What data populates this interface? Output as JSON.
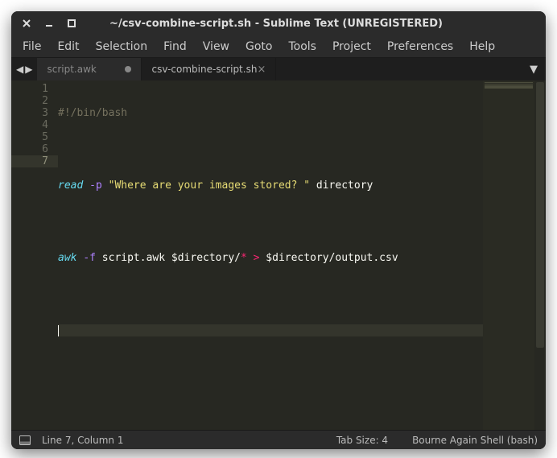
{
  "titlebar": {
    "title": "~/csv-combine-script.sh - Sublime Text (UNREGISTERED)"
  },
  "menubar": {
    "items": [
      "File",
      "Edit",
      "Selection",
      "Find",
      "View",
      "Goto",
      "Tools",
      "Project",
      "Preferences",
      "Help"
    ]
  },
  "tabs": {
    "items": [
      {
        "label": "script.awk",
        "active": false,
        "dirty": true
      },
      {
        "label": "csv-combine-script.sh",
        "active": true,
        "dirty": false
      }
    ]
  },
  "editor": {
    "line_count": 7,
    "current_line": 7,
    "code": {
      "l1_shebang": "#!/bin/bash",
      "l3_read": "read",
      "l3_flag": "-p",
      "l3_str": "\"Where are your images stored? \"",
      "l3_dir": "directory",
      "l5_awk": "awk",
      "l5_flag": "-f",
      "l5_script": "script.awk $directory/",
      "l5_star": "*",
      "l5_gt": ">",
      "l5_out": "$directory/output.csv"
    }
  },
  "statusbar": {
    "position": "Line 7, Column 1",
    "tabsize": "Tab Size: 4",
    "syntax": "Bourne Again Shell (bash)"
  }
}
